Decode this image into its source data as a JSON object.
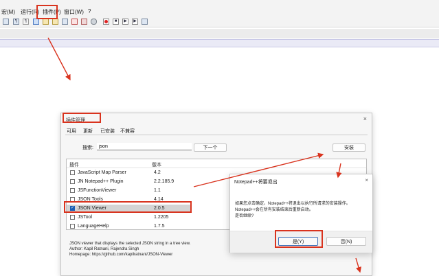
{
  "menubar": {
    "items": [
      "宏(M)",
      "运行(R)",
      "插件(P)",
      "窗口(W)",
      "?"
    ]
  },
  "toolbar": {
    "icons": [
      "file-list-icon",
      "paragraph-icon",
      "word-wrap-icon",
      "indent-guide-icon",
      "doc-map-icon",
      "function-list-icon",
      "folder-workspace-icon",
      "monitor-icon",
      "record-icon",
      "stop-icon",
      "play-icon",
      "play-multiple-icon",
      "save-macro-icon"
    ]
  },
  "plugin_dialog": {
    "title": "插件管理",
    "close_glyph": "×",
    "tabs": [
      "可用",
      "更新",
      "已安装",
      "不兼容"
    ],
    "search": {
      "label": "搜索:",
      "value": "json"
    },
    "next_button": "下一个",
    "install_button": "安装",
    "columns": {
      "name": "插件",
      "version": "版本"
    },
    "plugins": [
      {
        "name": "JavaScript Map Parser",
        "version": "4.2",
        "checked": false
      },
      {
        "name": "JN Notepad++ Plugin",
        "version": "2.2.185.9",
        "checked": false
      },
      {
        "name": "JSFunctionViewer",
        "version": "1.1",
        "checked": false
      },
      {
        "name": "JSON Tools",
        "version": "4.14",
        "checked": false
      },
      {
        "name": "JSON Viewer",
        "version": "2.0.5",
        "checked": true
      },
      {
        "name": "JSTool",
        "version": "1.2205",
        "checked": false
      },
      {
        "name": "LanguageHelp",
        "version": "1.7.5",
        "checked": false
      }
    ],
    "description": [
      "JSON viewer that displays the selected JSON string in a tree view.",
      "Author: Kapil Ratnani, Rajendra Singh",
      "Homepage: https://github.com/kapilratnani/JSON-Viewer"
    ]
  },
  "confirm_dialog": {
    "title": "Notepad++将要退出",
    "close_glyph": "×",
    "message": [
      "如果您点击确定，Notepad++将退出以执行所请求的安装操作。",
      "Notepad++会在所有安装结束后重新启动。",
      "是否继续?"
    ],
    "yes_button": "是(Y)",
    "no_button": "否(N)"
  },
  "colors": {
    "annotation": "#d9331e",
    "checkbox_accent": "#1a5fb4",
    "selected_row": "#d4d4d4"
  }
}
